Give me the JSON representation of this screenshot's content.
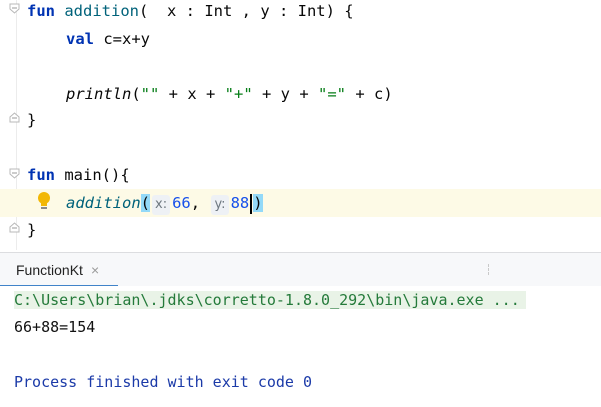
{
  "editor": {
    "lines": {
      "l1": {
        "kw": "fun",
        "name": "addition",
        "params": "(  x : Int , y : Int) {"
      },
      "l2": {
        "kw": "val",
        "rest": "c=x+y"
      },
      "l4": {
        "fn": "println",
        "p1": "(",
        "s1": "\"\"",
        "t1": " + x + ",
        "s2": "\"+\"",
        "t2": " + y + ",
        "s3": "\"=\"",
        "t3": " + c)"
      },
      "l5": {
        "text": "}"
      },
      "l7": {
        "kw": "fun",
        "rest": "main(){"
      },
      "l8": {
        "fn": "addition",
        "paren_open": "(",
        "hint_x": "x:",
        "arg1": "66",
        "comma": ",",
        "hint_y": "y:",
        "arg2": "88",
        "paren_close": ")"
      },
      "l9": {
        "text": "}"
      }
    }
  },
  "run_panel": {
    "tab_label": "FunctionKt",
    "tab_close": "×",
    "console": {
      "command": "C:\\Users\\brian\\.jdks\\corretto-1.8.0_292\\bin\\java.exe ...",
      "output": "66+88=154",
      "exit": "Process finished with exit code 0"
    }
  },
  "colors": {
    "keyword": "#0033b3",
    "string": "#067d17",
    "number": "#1750eb",
    "current_line": "#fdfae6",
    "console_exit": "#1b3aa8"
  }
}
